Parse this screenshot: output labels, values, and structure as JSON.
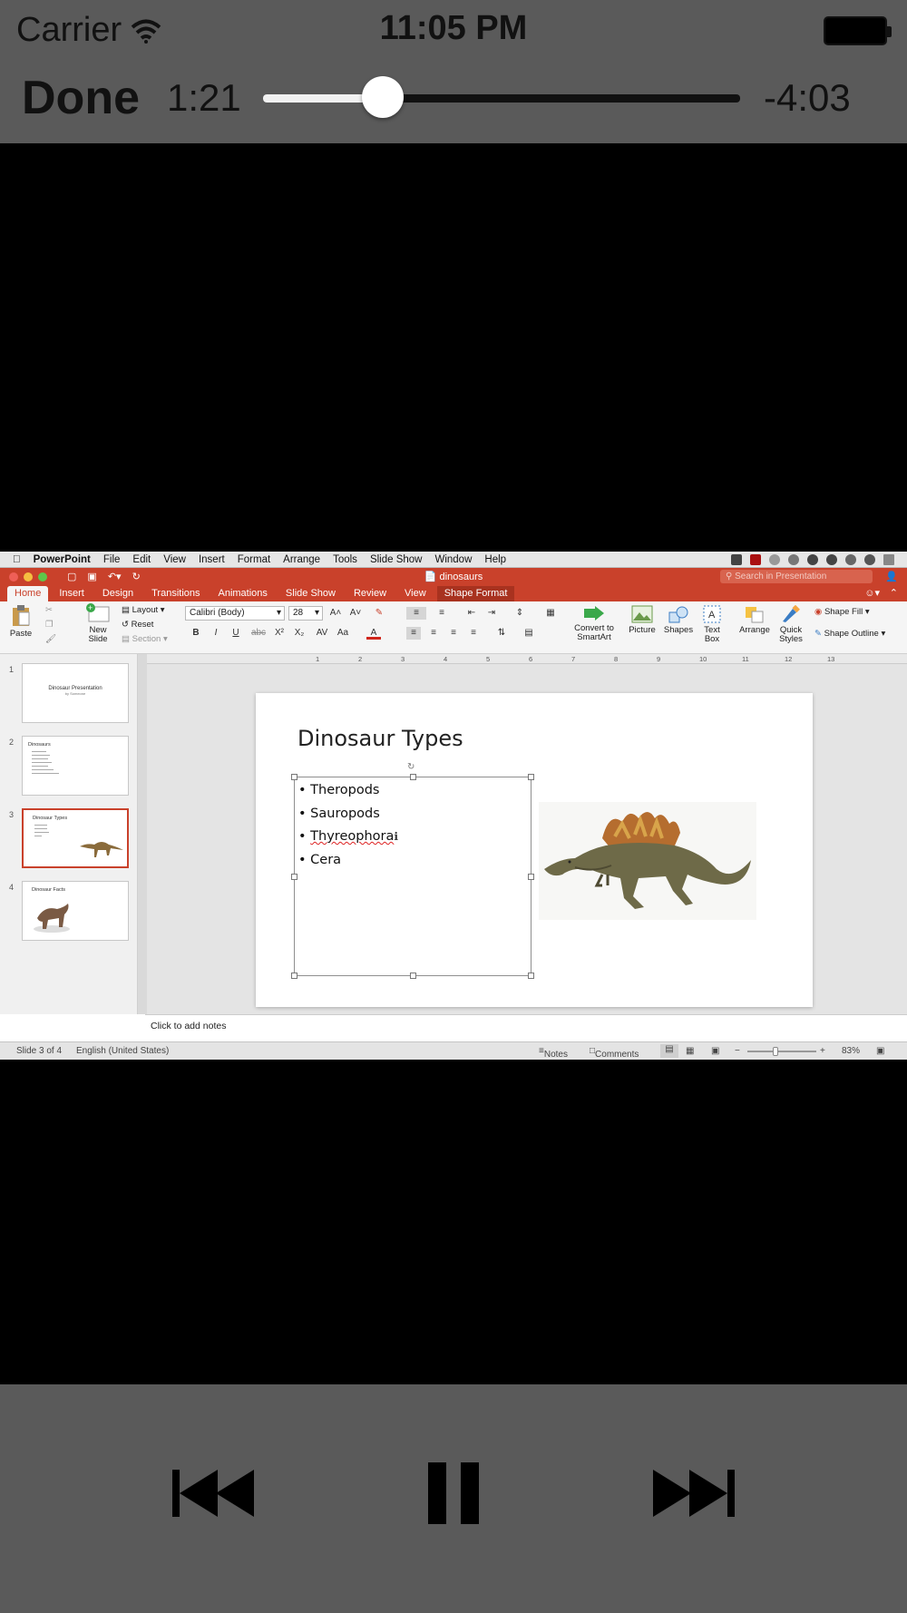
{
  "status": {
    "carrier": "Carrier",
    "time": "11:05 PM"
  },
  "player": {
    "done_label": "Done",
    "elapsed": "1:21",
    "remaining": "-4:03",
    "progress": 0.25,
    "controls": [
      "previous-track",
      "pause",
      "next-track"
    ]
  },
  "mac_menu": {
    "app_name": "PowerPoint",
    "items": [
      "File",
      "Edit",
      "View",
      "Insert",
      "Format",
      "Arrange",
      "Tools",
      "Slide Show",
      "Window",
      "Help"
    ]
  },
  "window": {
    "doc_title": "dinosaurs",
    "search_placeholder": "Search in Presentation"
  },
  "ribbon": {
    "tabs": [
      "Home",
      "Insert",
      "Design",
      "Transitions",
      "Animations",
      "Slide Show",
      "Review",
      "View",
      "Shape Format"
    ],
    "paste": "Paste",
    "new_slide_1": "New",
    "new_slide_2": "Slide",
    "layout": "Layout",
    "reset": "Reset",
    "section": "Section",
    "font_name": "Calibri (Body)",
    "font_size": "28",
    "convert_1": "Convert to",
    "convert_2": "SmartArt",
    "picture": "Picture",
    "shapes": "Shapes",
    "textbox_1": "Text",
    "textbox_2": "Box",
    "arrange": "Arrange",
    "quick_1": "Quick",
    "quick_2": "Styles",
    "shape_fill": "Shape Fill",
    "shape_outline": "Shape Outline",
    "bold": "B",
    "italic": "I",
    "underline": "U",
    "strike": "abc"
  },
  "ruler": [
    "1",
    "2",
    "3",
    "4",
    "5",
    "6",
    "7",
    "8",
    "9",
    "10",
    "11",
    "12",
    "13"
  ],
  "thumbnails": [
    {
      "num": "1",
      "title": "Dinosaur Presentation",
      "sub": "by Someone"
    },
    {
      "num": "2",
      "title": "Dinosaurs",
      "sub": ""
    },
    {
      "num": "3",
      "title": "Dinosaur Types",
      "sub": ""
    },
    {
      "num": "4",
      "title": "Dinosaur Facts",
      "sub": ""
    }
  ],
  "slide": {
    "title": "Dinosaur Types",
    "bullets": [
      "Theropods",
      "Sauropods",
      "Thyreophora",
      "Cera"
    ]
  },
  "notes_placeholder": "Click to add notes",
  "statusbar": {
    "slide_count": "Slide 3 of 4",
    "language": "English (United States)",
    "notes": "Notes",
    "comments": "Comments",
    "zoom": "83%"
  },
  "colors": {
    "ppt_red": "#c9412b",
    "player_gray": "#5a5a5a"
  }
}
